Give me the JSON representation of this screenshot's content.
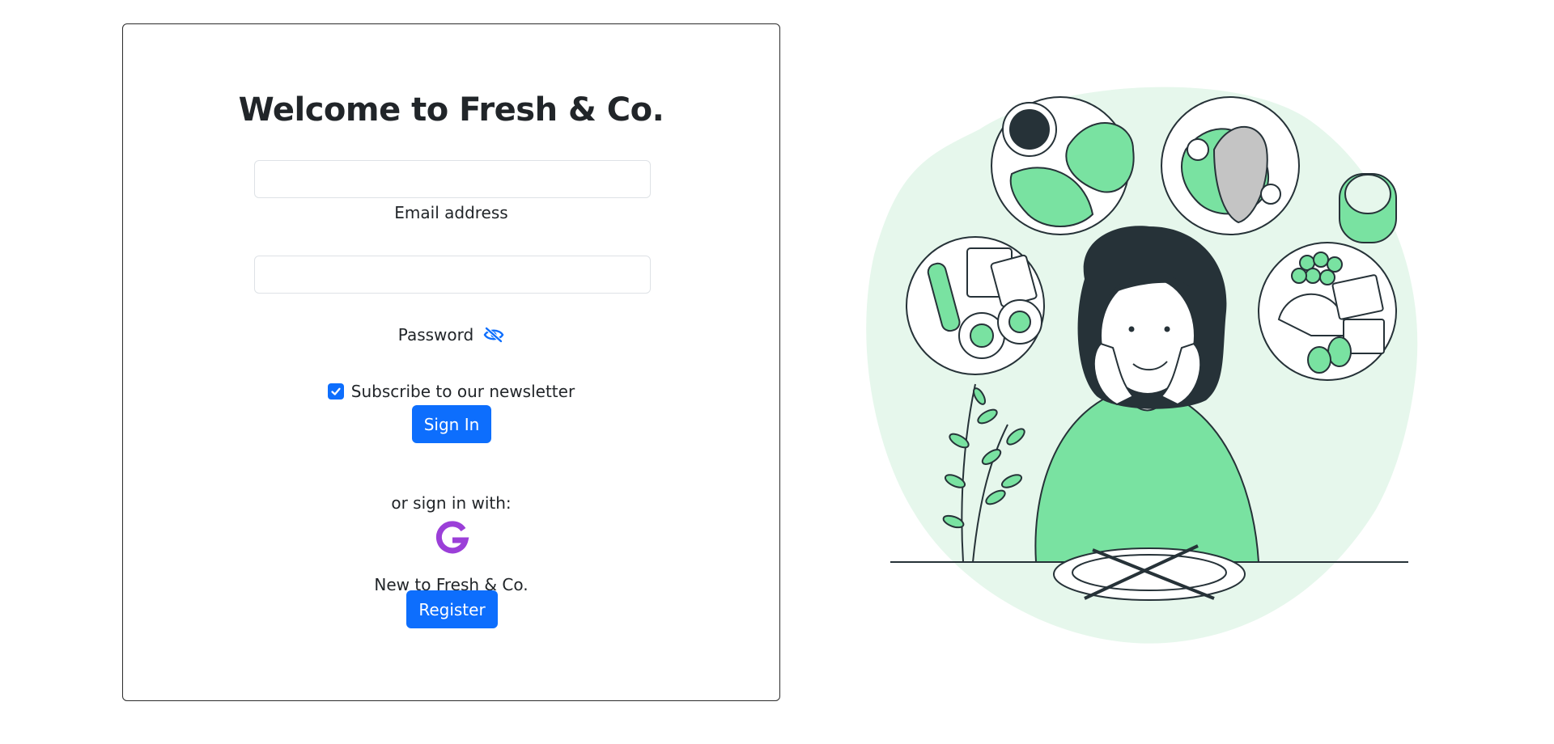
{
  "form": {
    "title": "Welcome to Fresh & Co.",
    "email": {
      "label": "Email address",
      "value": "",
      "placeholder": ""
    },
    "password": {
      "label": "Password",
      "value": "",
      "placeholder": ""
    },
    "newsletter": {
      "label": "Subscribe to our newsletter",
      "checked": true
    },
    "sign_in_label": "Sign In",
    "or_text": "or sign in with:",
    "google_icon": "google-icon",
    "new_text": "New to Fresh & Co.",
    "register_label": "Register"
  },
  "colors": {
    "primary": "#0d6efd",
    "google": "#9b3fd8",
    "illustration_green": "#79e2a1",
    "illustration_bg": "#e6f7ec",
    "illustration_dark": "#263238"
  }
}
